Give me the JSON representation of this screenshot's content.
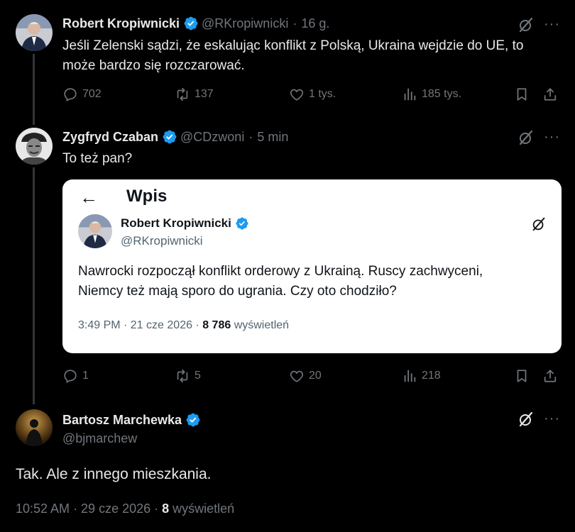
{
  "tweet1": {
    "name": "Robert Kropiwnicki",
    "handle": "@RKropiwnicki",
    "time": "16 g.",
    "text_line1": "Jeśli Zelenski sądzi, że eskalując konflikt z Polską, Ukraina wejdzie do UE, to",
    "text_line2": "może bardzo się rozczarować.",
    "replies": "702",
    "reposts": "137",
    "likes": "1 tys.",
    "views": "185 tys."
  },
  "tweet2": {
    "name": "Zygfryd Czaban",
    "handle": "@CDzwoni",
    "time": "5 min",
    "text": "To też pan?",
    "replies": "1",
    "reposts": "5",
    "likes": "20",
    "views": "218"
  },
  "quoted_screenshot": {
    "back_arrow": "←",
    "page_title": "Wpis",
    "name": "Robert Kropiwnicki",
    "handle": "@RKropiwnicki",
    "text_line1": "Nawrocki rozpoczął konflikt orderowy z Ukrainą. Ruscy zachwyceni,",
    "text_line2": "Niemcy też mają sporo do ugrania. Czy oto chodziło?",
    "timestamp": "3:49 PM · 21 cze 2026 · ",
    "views_count": "8 786",
    "views_label": " wyświetleń"
  },
  "tweet3": {
    "name": "Bartosz Marchewka",
    "handle": "@bjmarchew",
    "text": "Tak. Ale z innego mieszkania.",
    "timestamp": "10:52 AM · 29 cze 2026 · ",
    "views_count": "8",
    "views_label": " wyświetleń"
  },
  "ui": {
    "separator": "·",
    "more": "···"
  },
  "colors": {
    "background": "#000000",
    "verified_blue": "#1d9bf0",
    "muted": "#71767b",
    "text": "#e7e9ea"
  },
  "icons": [
    "verified-badge-icon",
    "grok-icon",
    "more-icon",
    "reply-icon",
    "repost-icon",
    "like-icon",
    "views-icon",
    "bookmark-icon",
    "share-icon",
    "back-arrow-icon"
  ]
}
